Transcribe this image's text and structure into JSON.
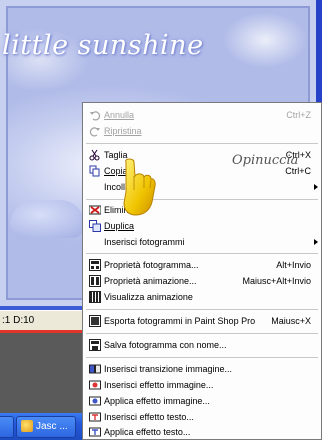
{
  "background": {
    "title_text": "little sunshine"
  },
  "statusbar": {
    "text": ":1  D:10"
  },
  "taskbar": {
    "button_label": "Jasc ..."
  },
  "watermark": {
    "text": "Opinuccia"
  },
  "menu": {
    "items": [
      {
        "label": "Annulla",
        "shortcut": "Ctrl+Z",
        "icon": "undo-icon",
        "disabled": true
      },
      {
        "label": "Ripristina",
        "shortcut": "",
        "icon": "redo-icon",
        "disabled": true
      },
      {
        "label": "Taglia",
        "shortcut": "Ctrl+X",
        "icon": "scissors-icon"
      },
      {
        "label": "Copia",
        "shortcut": "Ctrl+C",
        "icon": "copy-icon"
      },
      {
        "label": "Incolla",
        "shortcut": "",
        "icon": "",
        "submenu": true
      },
      {
        "label": "Elimina",
        "shortcut": "",
        "icon": "delete-icon"
      },
      {
        "label": "Duplica",
        "shortcut": "",
        "icon": "duplicate-icon"
      },
      {
        "label": "Inserisci fotogrammi",
        "shortcut": "",
        "icon": "",
        "submenu": true
      },
      {
        "label": "Proprietà fotogramma...",
        "shortcut": "Alt+Invio",
        "icon": "frame-properties-icon"
      },
      {
        "label": "Proprietà animazione...",
        "shortcut": "Maiusc+Alt+Invio",
        "icon": "animation-properties-icon"
      },
      {
        "label": "Visualizza animazione",
        "shortcut": "",
        "icon": "view-animation-icon"
      },
      {
        "label": "Esporta fotogrammi in Paint Shop Pro",
        "shortcut": "Maiusc+X",
        "icon": "export-icon"
      },
      {
        "label": "Salva fotogramma con nome...",
        "shortcut": "",
        "icon": "save-icon"
      },
      {
        "label": "Inserisci transizione immagine...",
        "shortcut": "",
        "icon": "transition-icon"
      },
      {
        "label": "Inserisci effetto immagine...",
        "shortcut": "",
        "icon": "image-effect-icon"
      },
      {
        "label": "Applica effetto immagine...",
        "shortcut": "",
        "icon": "apply-image-effect-icon"
      },
      {
        "label": "Inserisci effetto testo...",
        "shortcut": "",
        "icon": "text-effect-icon"
      },
      {
        "label": "Applica effetto testo...",
        "shortcut": "",
        "icon": "apply-text-effect-icon"
      }
    ]
  }
}
